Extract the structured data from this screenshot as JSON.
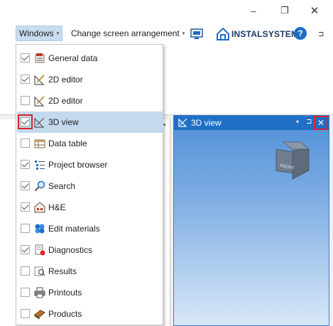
{
  "window_controls": {
    "minimize": "–",
    "restore": "❐",
    "close": "✕"
  },
  "menu": {
    "windows_label": "Windows",
    "arrange_label": "Change screen arrangement",
    "caret": "▾"
  },
  "brand": {
    "name": "INSTALSYSTEM"
  },
  "help": {
    "label": "?"
  },
  "view_panel": {
    "title": "3D view",
    "close": "✕",
    "pin": "⊐",
    "dropdown": "▾",
    "cube_front": "FRONT"
  },
  "colors": {
    "accent": "#1f6fc5",
    "highlight": "#e0222a",
    "selected_row": "#c4d9ee"
  },
  "windows_menu": {
    "items": [
      {
        "label": "General data",
        "checked": true,
        "icon": "general-data-icon"
      },
      {
        "label": "2D editor",
        "checked": true,
        "icon": "2d-editor-icon"
      },
      {
        "label": "2D editor",
        "checked": false,
        "icon": "2d-editor-icon"
      },
      {
        "label": "3D view",
        "checked": true,
        "icon": "3d-view-icon"
      },
      {
        "label": "Data table",
        "checked": false,
        "icon": "data-table-icon"
      },
      {
        "label": "Project browser",
        "checked": true,
        "icon": "project-browser-icon"
      },
      {
        "label": "Search",
        "checked": true,
        "icon": "search-icon"
      },
      {
        "label": "H&E",
        "checked": true,
        "icon": "building-icon"
      },
      {
        "label": "Edit materials",
        "checked": false,
        "icon": "materials-icon"
      },
      {
        "label": "Diagnostics",
        "checked": true,
        "icon": "diagnostics-icon"
      },
      {
        "label": "Results",
        "checked": false,
        "icon": "results-icon"
      },
      {
        "label": "Printouts",
        "checked": false,
        "icon": "printer-icon"
      },
      {
        "label": "Products",
        "checked": false,
        "icon": "products-icon"
      }
    ]
  }
}
